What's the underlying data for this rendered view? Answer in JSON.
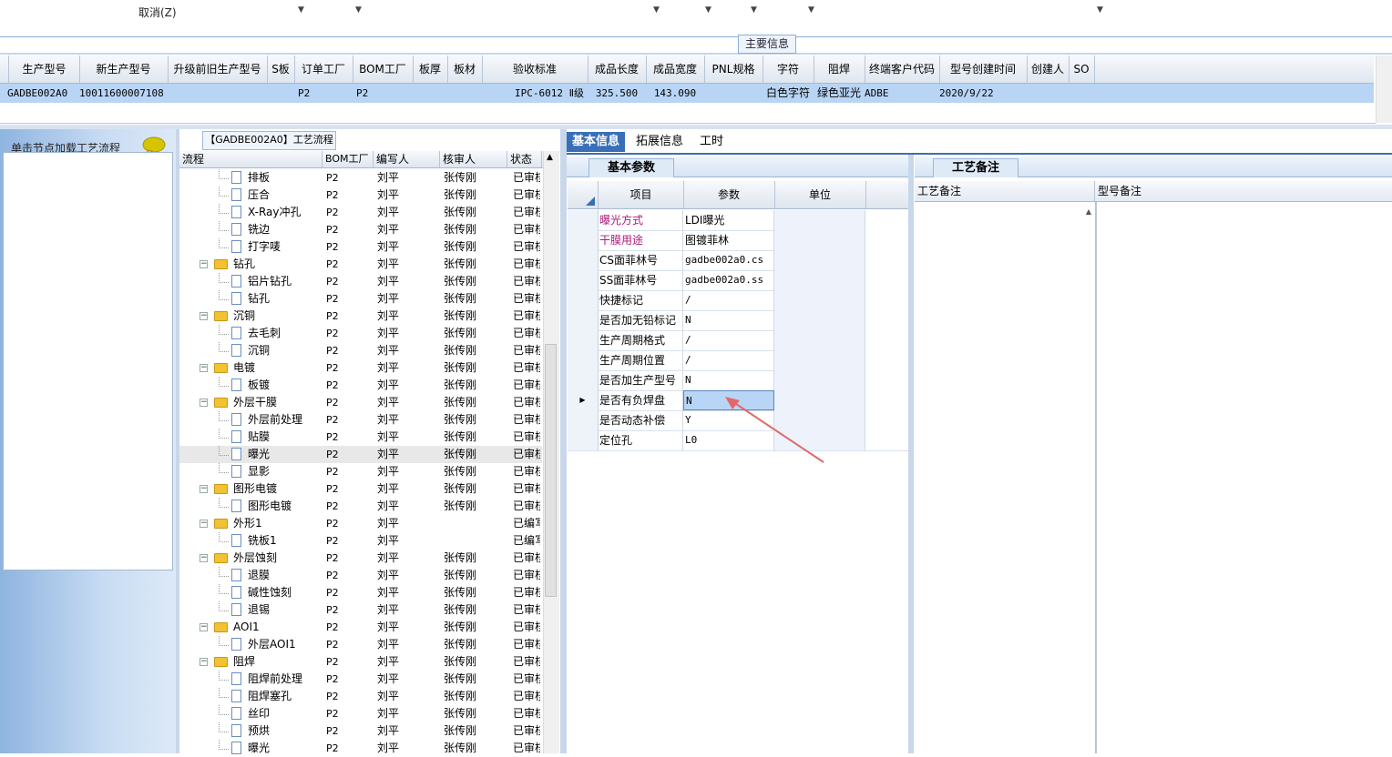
{
  "toolbar": {
    "cancel_label": "取消(Z)"
  },
  "main_section_title": "主要信息",
  "main_grid": {
    "columns": [
      "生产型号",
      "新生产型号",
      "升级前旧生产型号",
      "S板",
      "订单工厂",
      "BOM工厂",
      "板厚",
      "板材",
      "验收标准",
      "成品长度",
      "成品宽度",
      "PNL规格",
      "字符",
      "阻焊",
      "终端客户代码",
      "型号创建时间",
      "创建人",
      "SO"
    ],
    "row": [
      "GADBE002A0",
      "10011600007108",
      "",
      "",
      "P2",
      "P2",
      "",
      "",
      "IPC-6012 Ⅱ级",
      "325.500",
      "143.090",
      "",
      "白色字符",
      "绿色亚光",
      "ADBE",
      "2020/9/22",
      "",
      ""
    ]
  },
  "left_panel": {
    "title": "单击节点加载工艺流程",
    "bubble_icon": "speech-bubble-icon"
  },
  "tree_panel": {
    "title": "【GADBE002A0】工艺流程",
    "columns": [
      "流程",
      "BOM工厂",
      "编写人",
      "核审人",
      "状态"
    ],
    "rows": [
      {
        "level": 1,
        "type": "doc",
        "name": "排板",
        "bom": "P2",
        "writer": "刘平",
        "reviewer": "张传刚",
        "status": "已审核"
      },
      {
        "level": 1,
        "type": "doc",
        "name": "压合",
        "bom": "P2",
        "writer": "刘平",
        "reviewer": "张传刚",
        "status": "已审核"
      },
      {
        "level": 1,
        "type": "doc",
        "name": "X-Ray冲孔",
        "bom": "P2",
        "writer": "刘平",
        "reviewer": "张传刚",
        "status": "已审核"
      },
      {
        "level": 1,
        "type": "doc",
        "name": "铣边",
        "bom": "P2",
        "writer": "刘平",
        "reviewer": "张传刚",
        "status": "已审核"
      },
      {
        "level": 1,
        "type": "doc",
        "name": "打字唛",
        "bom": "P2",
        "writer": "刘平",
        "reviewer": "张传刚",
        "status": "已审核"
      },
      {
        "level": 0,
        "type": "folder",
        "name": "钻孔",
        "bom": "P2",
        "writer": "刘平",
        "reviewer": "张传刚",
        "status": "已审核"
      },
      {
        "level": 1,
        "type": "doc",
        "name": "铝片钻孔",
        "bom": "P2",
        "writer": "刘平",
        "reviewer": "张传刚",
        "status": "已审核"
      },
      {
        "level": 1,
        "type": "doc",
        "name": "钻孔",
        "bom": "P2",
        "writer": "刘平",
        "reviewer": "张传刚",
        "status": "已审核"
      },
      {
        "level": 0,
        "type": "folder",
        "name": "沉铜",
        "bom": "P2",
        "writer": "刘平",
        "reviewer": "张传刚",
        "status": "已审核"
      },
      {
        "level": 1,
        "type": "doc",
        "name": "去毛刺",
        "bom": "P2",
        "writer": "刘平",
        "reviewer": "张传刚",
        "status": "已审核"
      },
      {
        "level": 1,
        "type": "doc",
        "name": "沉铜",
        "bom": "P2",
        "writer": "刘平",
        "reviewer": "张传刚",
        "status": "已审核"
      },
      {
        "level": 0,
        "type": "folder",
        "name": "电镀",
        "bom": "P2",
        "writer": "刘平",
        "reviewer": "张传刚",
        "status": "已审核"
      },
      {
        "level": 1,
        "type": "doc",
        "name": "板镀",
        "bom": "P2",
        "writer": "刘平",
        "reviewer": "张传刚",
        "status": "已审核"
      },
      {
        "level": 0,
        "type": "folder",
        "name": "外层干膜",
        "bom": "P2",
        "writer": "刘平",
        "reviewer": "张传刚",
        "status": "已审核"
      },
      {
        "level": 1,
        "type": "doc",
        "name": "外层前处理",
        "bom": "P2",
        "writer": "刘平",
        "reviewer": "张传刚",
        "status": "已审核"
      },
      {
        "level": 1,
        "type": "doc",
        "name": "贴膜",
        "bom": "P2",
        "writer": "刘平",
        "reviewer": "张传刚",
        "status": "已审核"
      },
      {
        "level": 1,
        "type": "doc",
        "name": "曝光",
        "bom": "P2",
        "writer": "刘平",
        "reviewer": "张传刚",
        "status": "已审核",
        "selected": true
      },
      {
        "level": 1,
        "type": "doc",
        "name": "显影",
        "bom": "P2",
        "writer": "刘平",
        "reviewer": "张传刚",
        "status": "已审核"
      },
      {
        "level": 0,
        "type": "folder",
        "name": "图形电镀",
        "bom": "P2",
        "writer": "刘平",
        "reviewer": "张传刚",
        "status": "已审核"
      },
      {
        "level": 1,
        "type": "doc",
        "name": "图形电镀",
        "bom": "P2",
        "writer": "刘平",
        "reviewer": "张传刚",
        "status": "已审核"
      },
      {
        "level": 0,
        "type": "folder",
        "name": "外形1",
        "bom": "P2",
        "writer": "刘平",
        "reviewer": "",
        "status": "已编写"
      },
      {
        "level": 1,
        "type": "doc",
        "name": "铣板1",
        "bom": "P2",
        "writer": "刘平",
        "reviewer": "",
        "status": "已编写"
      },
      {
        "level": 0,
        "type": "folder",
        "name": "外层蚀刻",
        "bom": "P2",
        "writer": "刘平",
        "reviewer": "张传刚",
        "status": "已审核"
      },
      {
        "level": 1,
        "type": "doc",
        "name": "退膜",
        "bom": "P2",
        "writer": "刘平",
        "reviewer": "张传刚",
        "status": "已审核"
      },
      {
        "level": 1,
        "type": "doc",
        "name": "碱性蚀刻",
        "bom": "P2",
        "writer": "刘平",
        "reviewer": "张传刚",
        "status": "已审核"
      },
      {
        "level": 1,
        "type": "doc",
        "name": "退锡",
        "bom": "P2",
        "writer": "刘平",
        "reviewer": "张传刚",
        "status": "已审核"
      },
      {
        "level": 0,
        "type": "folder",
        "name": "AOI1",
        "bom": "P2",
        "writer": "刘平",
        "reviewer": "张传刚",
        "status": "已审核"
      },
      {
        "level": 1,
        "type": "doc",
        "name": "外层AOI1",
        "bom": "P2",
        "writer": "刘平",
        "reviewer": "张传刚",
        "status": "已审核"
      },
      {
        "level": 0,
        "type": "folder",
        "name": "阻焊",
        "bom": "P2",
        "writer": "刘平",
        "reviewer": "张传刚",
        "status": "已审核"
      },
      {
        "level": 1,
        "type": "doc",
        "name": "阻焊前处理",
        "bom": "P2",
        "writer": "刘平",
        "reviewer": "张传刚",
        "status": "已审核"
      },
      {
        "level": 1,
        "type": "doc",
        "name": "阻焊塞孔",
        "bom": "P2",
        "writer": "刘平",
        "reviewer": "张传刚",
        "status": "已审核"
      },
      {
        "level": 1,
        "type": "doc",
        "name": "丝印",
        "bom": "P2",
        "writer": "刘平",
        "reviewer": "张传刚",
        "status": "已审核"
      },
      {
        "level": 1,
        "type": "doc",
        "name": "预烘",
        "bom": "P2",
        "writer": "刘平",
        "reviewer": "张传刚",
        "status": "已审核"
      },
      {
        "level": 1,
        "type": "doc",
        "name": "曝光",
        "bom": "P2",
        "writer": "刘平",
        "reviewer": "张传刚",
        "status": "已审核"
      }
    ]
  },
  "tabs": [
    "基本信息",
    "拓展信息",
    "工时"
  ],
  "params": {
    "subtab": "基本参数",
    "columns": [
      "项目",
      "参数",
      "单位"
    ],
    "rows": [
      {
        "name": "曝光方式",
        "value": "LDI曝光",
        "highlight": true
      },
      {
        "name": "干膜用途",
        "value": "图镀菲林",
        "highlight": true
      },
      {
        "name": "CS面菲林号",
        "value": "gadbe002a0.cs"
      },
      {
        "name": "SS面菲林号",
        "value": "gadbe002a0.ss"
      },
      {
        "name": "快捷标记",
        "value": "/"
      },
      {
        "name": "是否加无铅标记",
        "value": "N"
      },
      {
        "name": "生产周期格式",
        "value": "/"
      },
      {
        "name": "生产周期位置",
        "value": "/"
      },
      {
        "name": "是否加生产型号",
        "value": "N"
      },
      {
        "name": "是否有负焊盘",
        "value": "N",
        "current": true
      },
      {
        "name": "是否动态补偿",
        "value": "Y"
      },
      {
        "name": "定位孔",
        "value": "L0"
      }
    ]
  },
  "remarks": {
    "subtab": "工艺备注",
    "columns": [
      "工艺备注",
      "型号备注"
    ]
  },
  "colors": {
    "accent": "#3a6fb8",
    "selected_row": "#b9d5f5",
    "highlight_text": "#b0187a",
    "annotation_arrow": "#e06a6a"
  }
}
